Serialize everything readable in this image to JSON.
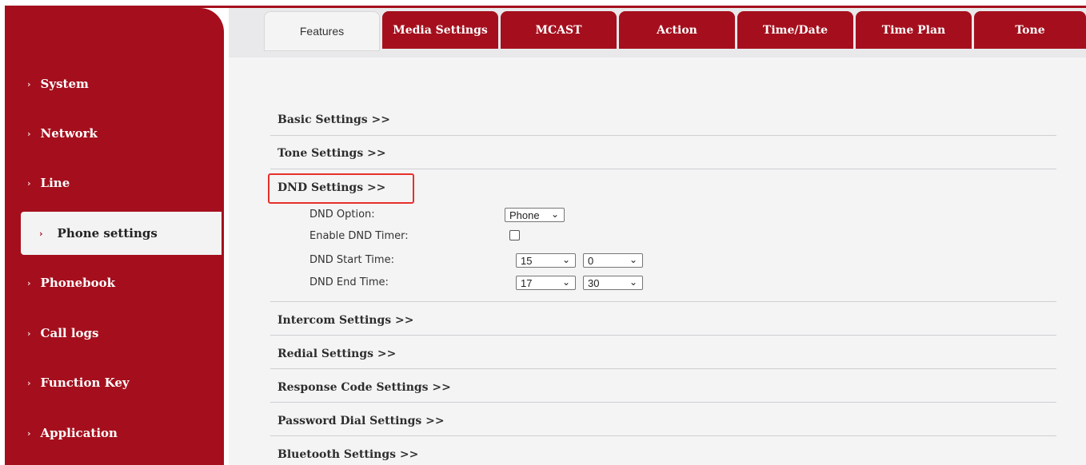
{
  "tabs": [
    "Features",
    "Media Settings",
    "MCAST",
    "Action",
    "Time/Date",
    "Time Plan",
    "Tone"
  ],
  "sidebar": {
    "items": [
      {
        "label": "System"
      },
      {
        "label": "Network"
      },
      {
        "label": "Line"
      },
      {
        "label": "Phone settings"
      },
      {
        "label": "Phonebook"
      },
      {
        "label": "Call logs"
      },
      {
        "label": "Function Key"
      },
      {
        "label": "Application"
      }
    ]
  },
  "sections": {
    "basic": "Basic Settings >>",
    "tone": "Tone Settings >>",
    "dnd": "DND Settings >>",
    "intercom": "Intercom Settings >>",
    "redial": "Redial Settings >>",
    "response": "Response Code Settings >>",
    "password": "Password Dial Settings >>",
    "bluetooth": "Bluetooth Settings >>"
  },
  "dnd": {
    "option_label": "DND Option:",
    "option_value": "Phone",
    "timer_label": "Enable DND Timer:",
    "timer_enabled": false,
    "start_label": "DND Start Time:",
    "start_hour": "15",
    "start_minute": "0",
    "end_label": "DND End Time:",
    "end_hour": "17",
    "end_minute": "30"
  },
  "icons": {
    "chevron": "chevron-right-icon",
    "caret": "chevron-down-icon"
  },
  "colors": {
    "brand": "#a50f1d",
    "highlight": "#e7302a"
  }
}
